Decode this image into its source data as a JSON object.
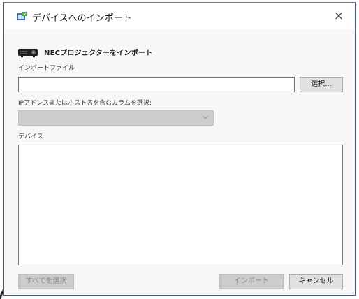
{
  "window": {
    "title": "デバイスへのインポート",
    "close_label": "×"
  },
  "header": {
    "heading": "NECプロジェクターをインポート"
  },
  "import_file": {
    "label": "インポートファイル",
    "value": "",
    "browse_label": "選択..."
  },
  "ip_column": {
    "label": "IPアドレスまたはホスト名を含むカラムを選択:",
    "selected": ""
  },
  "devices": {
    "label": "デバイス",
    "items": []
  },
  "footer": {
    "select_all_label": "すべてを選択",
    "import_label": "インポート",
    "cancel_label": "キャンセル"
  },
  "icons": {
    "app": "import-device-icon",
    "projector": "projector-icon",
    "dropdown": "chevron-down-icon"
  },
  "colors": {
    "window_border": "#4a5a78",
    "disabled_bg": "#cccccc",
    "button_bg": "#e1e1e1"
  }
}
